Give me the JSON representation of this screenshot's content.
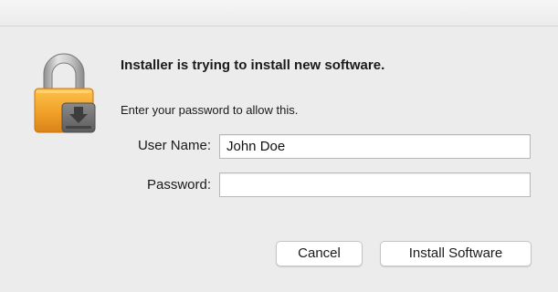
{
  "dialog": {
    "heading": "Installer is trying to install new software.",
    "message": "Enter your password to allow this.",
    "icon": "lock-installer-icon"
  },
  "form": {
    "username_label": "User Name:",
    "username_value": "John Doe",
    "password_label": "Password:",
    "password_value": ""
  },
  "buttons": {
    "cancel_label": "Cancel",
    "install_label": "Install Software"
  },
  "colors": {
    "lock_body": "#f0a328",
    "lock_shackle": "#b9b9b9",
    "background": "#ececec"
  }
}
